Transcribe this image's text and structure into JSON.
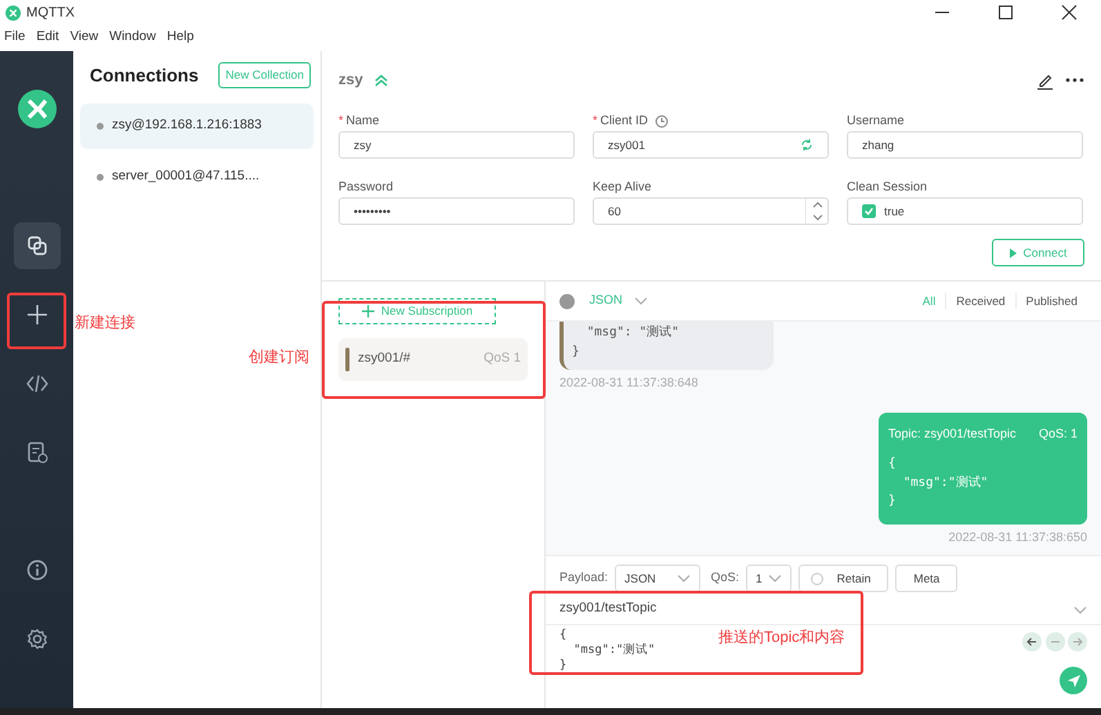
{
  "window": {
    "title": "MQTTX"
  },
  "menu": [
    "File",
    "Edit",
    "View",
    "Window",
    "Help"
  ],
  "nav": [
    {
      "kind": "connections",
      "selected": true
    },
    {
      "kind": "add",
      "selected": false
    },
    {
      "kind": "script",
      "selected": false
    },
    {
      "kind": "log",
      "selected": false
    }
  ],
  "nav_bottom": [
    {
      "kind": "about"
    },
    {
      "kind": "settings"
    }
  ],
  "connections": {
    "title": "Connections",
    "new_button": "New Collection",
    "items": [
      {
        "label": "zsy@192.168.1.216:1883",
        "selected": true
      },
      {
        "label": "server_00001@47.115....",
        "selected": false
      }
    ]
  },
  "connection": {
    "name": "zsy",
    "fields": [
      {
        "label": "Name",
        "required_mark": "*",
        "kind": "text",
        "value": "zsy"
      },
      {
        "label": "Client ID",
        "required_mark": "*",
        "kind": "clientid",
        "value": "zsy001"
      },
      {
        "label": "Username",
        "kind": "text",
        "value": "zhang"
      },
      {
        "label": "Password",
        "kind": "text",
        "value": "•••••••••"
      },
      {
        "label": "Keep Alive",
        "kind": "number",
        "value": "60"
      },
      {
        "label": "Clean Session",
        "kind": "checkbox",
        "value": "true",
        "checked": true
      }
    ],
    "connect_button": "Connect"
  },
  "subscriptions": {
    "new_button": "New Subscription",
    "items": [
      {
        "topic": "zsy001/#",
        "qos": "QoS 1",
        "color": "#8c7b5c"
      }
    ]
  },
  "messages": {
    "format": "JSON",
    "filters": [
      {
        "label": "All",
        "selected": true
      },
      {
        "label": "Received",
        "selected": false
      },
      {
        "label": "Published",
        "selected": false
      }
    ],
    "items": [
      {
        "kind": "received",
        "body": "  \"msg\": \"测试\"\n}",
        "time": "2022-08-31 11:37:38:648"
      },
      {
        "kind": "published",
        "topic": "Topic: zsy001/testTopic",
        "qos": "QoS: 1",
        "body": "{\n  \"msg\":\"测试\"\n}",
        "time": "2022-08-31 11:37:38:650"
      }
    ]
  },
  "publish": {
    "payload_label": "Payload:",
    "format": "JSON",
    "qos_label": "QoS:",
    "qos": "1",
    "retain": {
      "label": "Retain",
      "checked": false
    },
    "meta_button": "Meta",
    "topic": "zsy001/testTopic",
    "body": "{\n  \"msg\":\"测试\"\n}"
  },
  "annotations": [
    {
      "text": "新建连接"
    },
    {
      "text": "创建订阅"
    },
    {
      "text": "推送的Topic和内容"
    }
  ]
}
